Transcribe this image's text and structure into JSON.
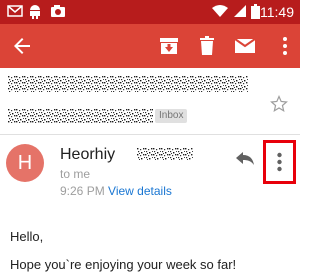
{
  "status_bar": {
    "time": "11:49",
    "left_icons": [
      "gmail-icon",
      "android-icon",
      "image-notification-icon"
    ],
    "right_icons": [
      "wifi-icon",
      "signal-icon",
      "battery-icon"
    ],
    "colors": {
      "background": "#b71c1c"
    }
  },
  "toolbar": {
    "back": "back-arrow-icon",
    "actions": [
      "archive-icon",
      "delete-icon",
      "mail-icon"
    ],
    "colors": {
      "background": "#db4437"
    }
  },
  "subject": {
    "label_chip": "Inbox"
  },
  "message": {
    "avatar_letter": "H",
    "sender_name": "Heorhiy",
    "recipient": "to me",
    "time": "9:26 PM",
    "view_details": "View details",
    "colors": {
      "avatar": "#e57368",
      "highlight": "#e8000b",
      "link": "#1976d2"
    }
  },
  "body": {
    "greeting": "Hello,",
    "line1": "Hope you`re enjoying your week so far!"
  }
}
